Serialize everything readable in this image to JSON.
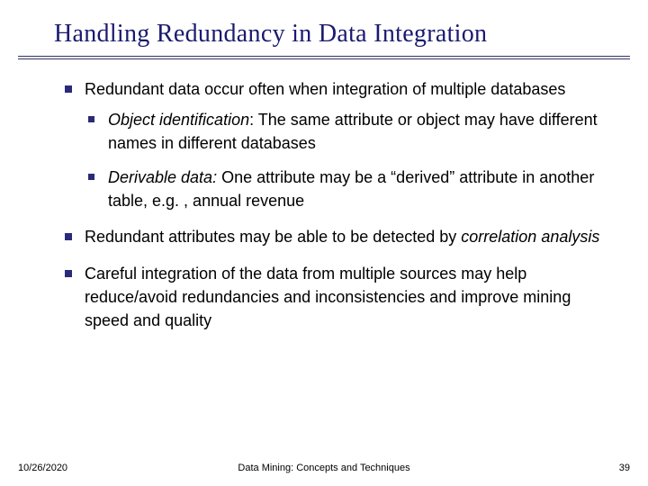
{
  "slide": {
    "title": "Handling Redundancy in Data Integration",
    "bullets": {
      "b1_intro": "Redundant data occur often when integration of multiple databases",
      "b1_sub1_term": "Object identification",
      "b1_sub1_rest": ":  The same attribute or object may have different names in different databases",
      "b1_sub2_term": "Derivable data:",
      "b1_sub2_rest": " One attribute may be a “derived” attribute in another table, e.g. , annual revenue",
      "b2_pre": "Redundant attributes may be able to be detected by ",
      "b2_term": "correlation analysis",
      "b3": "Careful integration of the data from multiple sources may help reduce/avoid redundancies and inconsistencies and improve mining speed and quality"
    }
  },
  "footer": {
    "date": "10/26/2020",
    "center": "Data Mining: Concepts and Techniques",
    "page": "39"
  }
}
